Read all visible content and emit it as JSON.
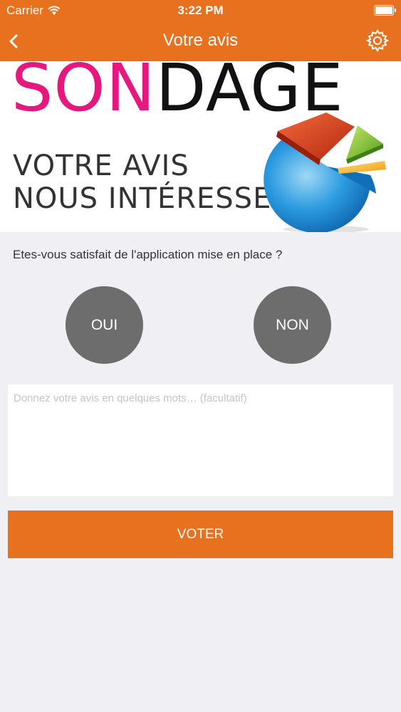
{
  "status_bar": {
    "carrier": "Carrier",
    "time": "3:22 PM",
    "wifi_icon": "wifi-icon",
    "battery_icon": "battery-icon"
  },
  "nav": {
    "title": "Votre avis",
    "back_icon": "chevron-left-icon",
    "settings_icon": "gear-icon"
  },
  "banner": {
    "word_part1": "SON",
    "word_part2": "DAGE",
    "slogan_line1": "VOTRE AVIS",
    "slogan_line2": "NOUS INTÉRESSE",
    "pie_icon": "pie-chart-illustration"
  },
  "survey": {
    "question": "Etes-vous satisfait de l'application mise en place ?",
    "yes_label": "OUI",
    "no_label": "NON",
    "comment_placeholder": "Donnez votre avis en quelques mots… (facultatif)",
    "comment_value": "",
    "submit_label": "VOTER"
  },
  "colors": {
    "accent": "#e8711f",
    "pink": "#e6187f",
    "choice_bg": "#6d6d6d",
    "page_bg": "#efeff4"
  }
}
